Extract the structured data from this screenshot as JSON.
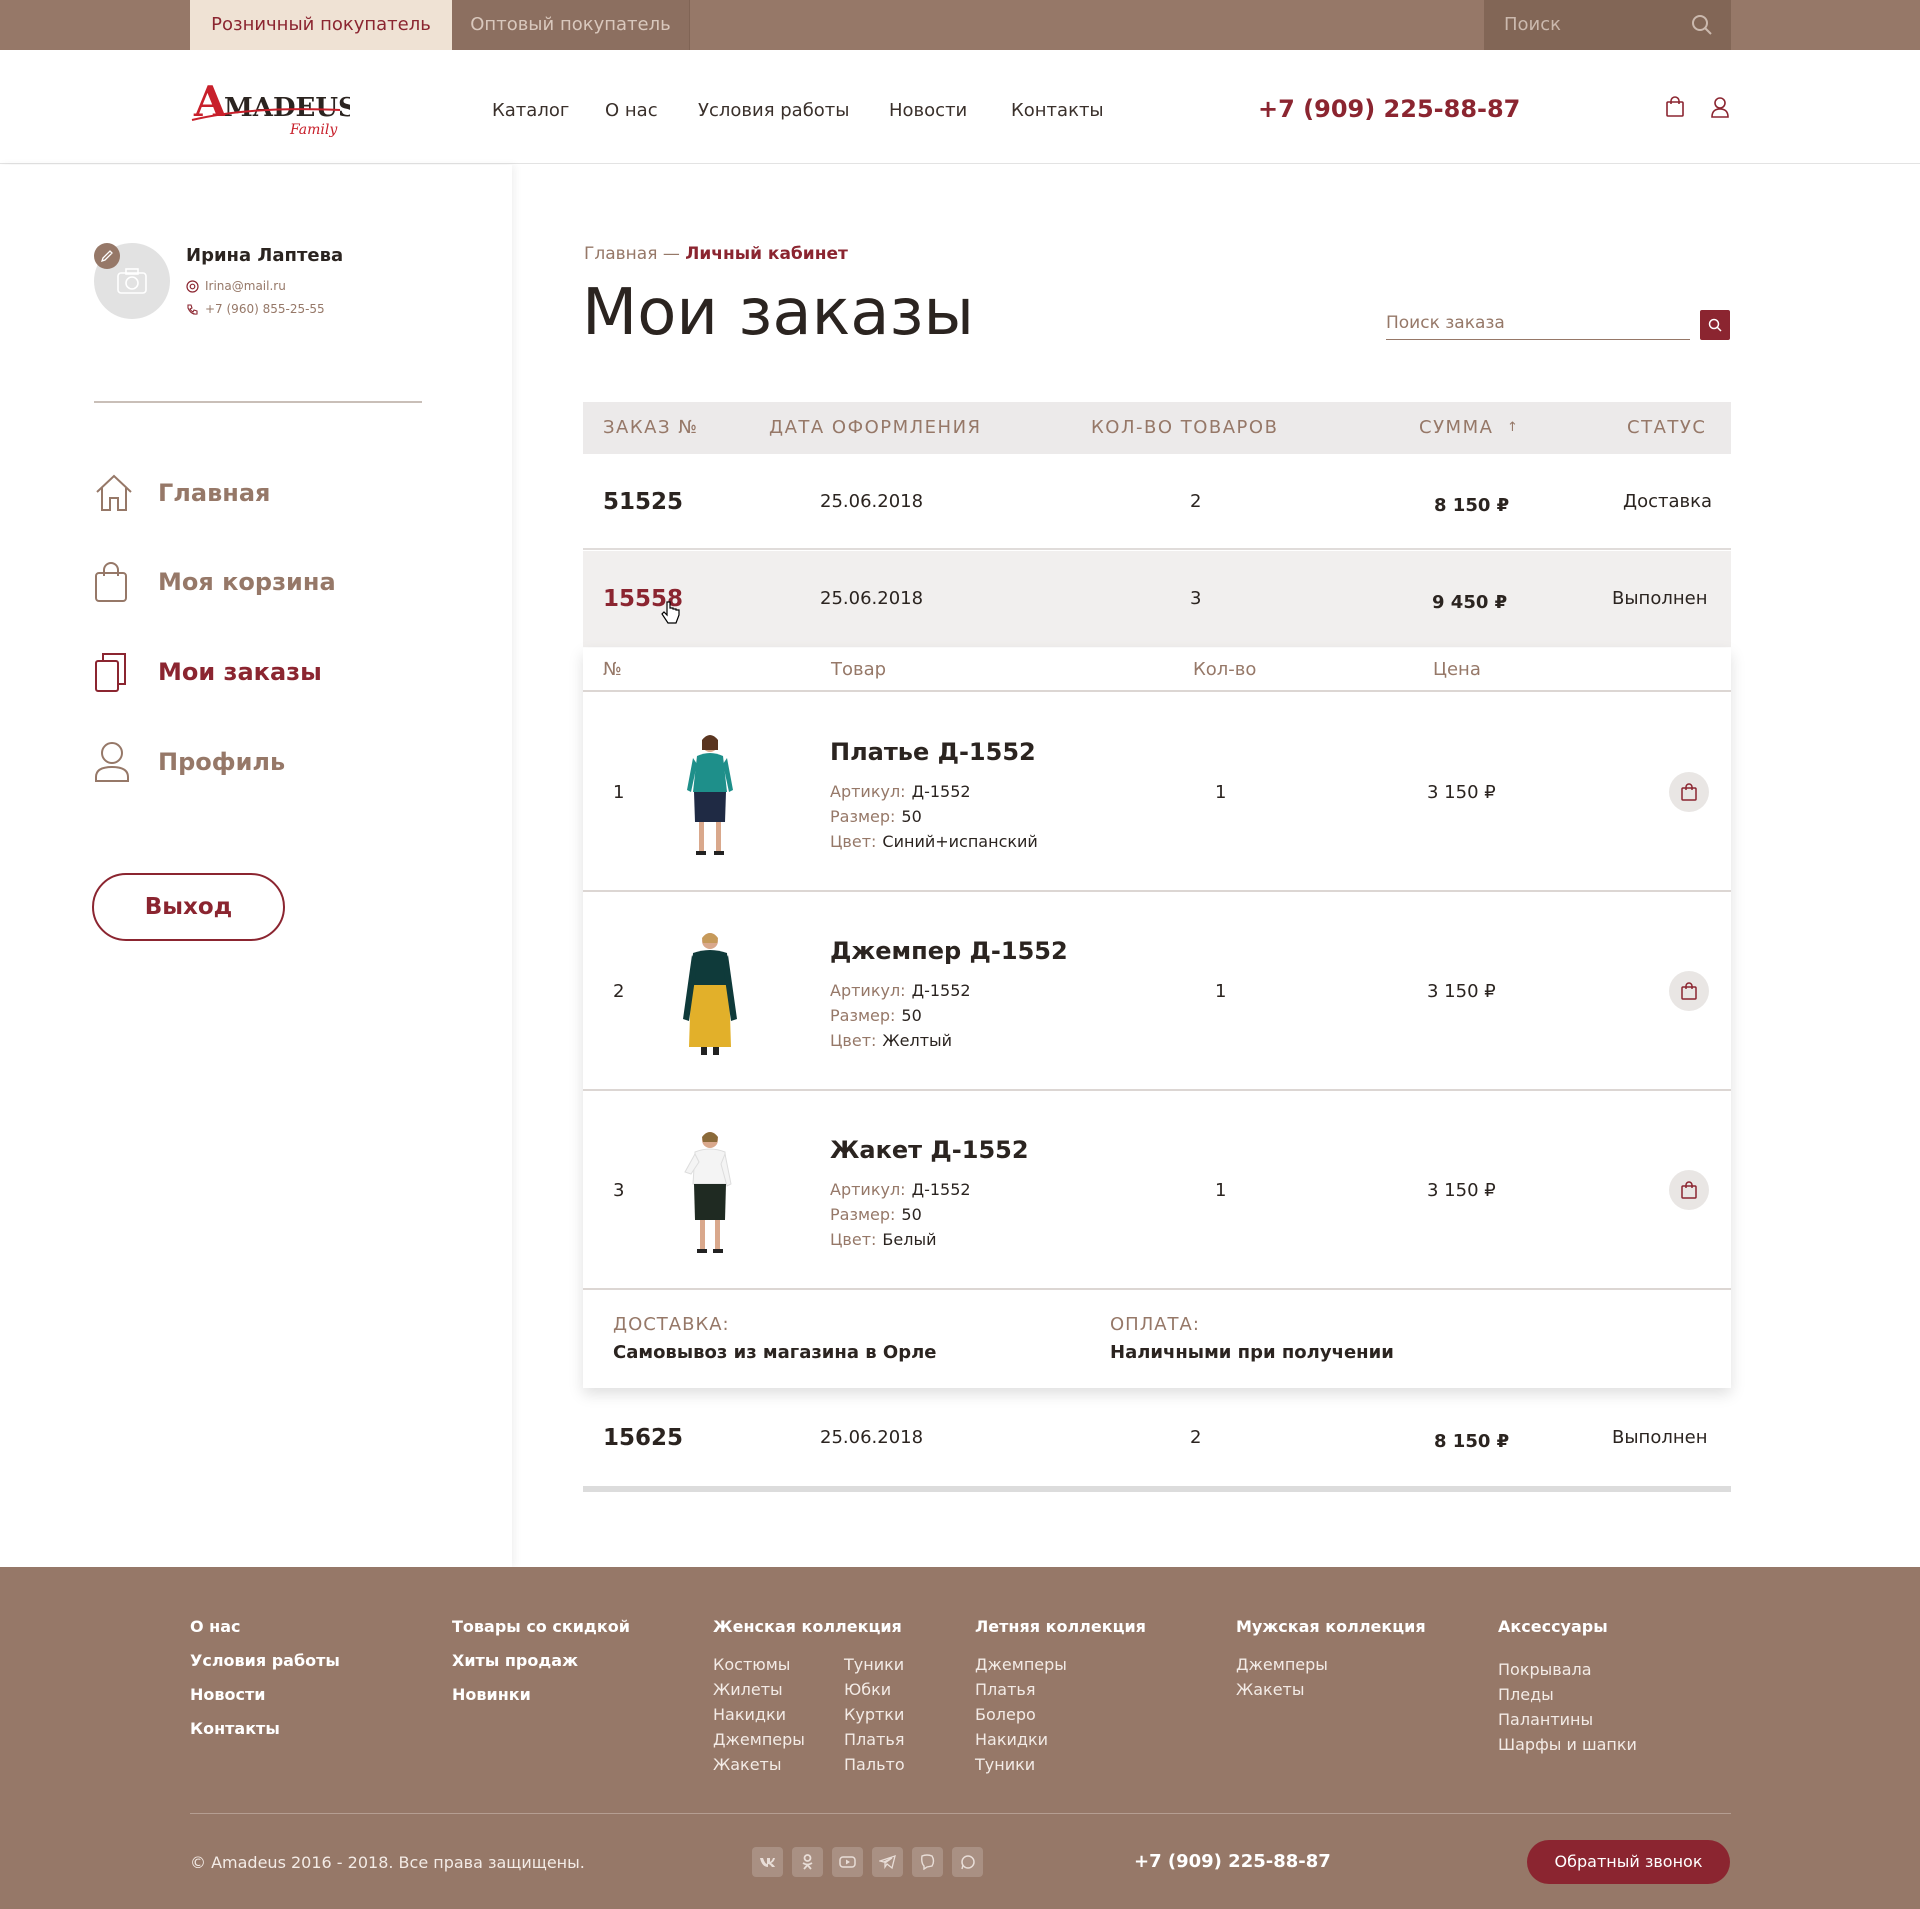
{
  "topbar": {
    "tab_retail": "Розничный покупатель",
    "tab_wholesale": "Оптовый покупатель",
    "search_placeholder": "Поиск"
  },
  "header": {
    "logo_text": "AMADEUS",
    "logo_sub": "Family",
    "nav": [
      "Каталог",
      "О нас",
      "Условия работы",
      "Новости",
      "Контакты"
    ],
    "phone": "+7 (909) 225-88-87"
  },
  "user": {
    "name": "Ирина Лаптева",
    "email": "Irina@mail.ru",
    "phone": "+7 (960) 855-25-55"
  },
  "sidebar": {
    "items": [
      {
        "label": "Главная",
        "icon": "home-icon"
      },
      {
        "label": "Моя корзина",
        "icon": "shopping-bag-icon"
      },
      {
        "label": "Мои заказы",
        "icon": "orders-icon",
        "active": true
      },
      {
        "label": "Профиль",
        "icon": "user-icon"
      }
    ],
    "logout": "Выход"
  },
  "breadcrumb": {
    "home": "Главная",
    "sep": "—",
    "current": "Личный кабинет"
  },
  "page_title": "Мои заказы",
  "order_search_placeholder": "Поиск заказа",
  "orders_table": {
    "headers": [
      "ЗАКАЗ №",
      "ДАТА ОФОРМЛЕНИЯ",
      "КОЛ-ВО ТОВАРОВ",
      "СУММА",
      "СТАТУС"
    ],
    "sort_indicator": "↑",
    "rows": [
      {
        "no": "51525",
        "date": "25.06.2018",
        "qty": "2",
        "sum": "8 150",
        "currency": "₽",
        "status": "Доставка"
      },
      {
        "no": "15558",
        "date": "25.06.2018",
        "qty": "3",
        "sum": "9 450",
        "currency": "₽",
        "status": "Выполнен"
      },
      {
        "no": "15625",
        "date": "25.06.2018",
        "qty": "2",
        "sum": "8 150",
        "currency": "₽",
        "status": "Выполнен"
      }
    ]
  },
  "order_detail": {
    "headers": [
      "№",
      "Товар",
      "Кол-во",
      "Цена"
    ],
    "labels": {
      "article": "Артикул:",
      "size": "Размер:",
      "color": "Цвет:"
    },
    "items": [
      {
        "num": "1",
        "name": "Платье Д-1552",
        "article": "Д-1552",
        "size": "50",
        "color": "Синий+испанский",
        "qty": "1",
        "price": "3 150 ₽"
      },
      {
        "num": "2",
        "name": "Джемпер Д-1552",
        "article": "Д-1552",
        "size": "50",
        "color": "Желтый",
        "qty": "1",
        "price": "3 150 ₽"
      },
      {
        "num": "3",
        "name": "Жакет Д-1552",
        "article": "Д-1552",
        "size": "50",
        "color": "Белый",
        "qty": "1",
        "price": "3 150 ₽"
      }
    ],
    "delivery_label": "ДОСТАВКА:",
    "delivery_value": "Самовывоз из магазина в Орле",
    "payment_label": "ОПЛАТА:",
    "payment_value": "Наличными при получении"
  },
  "footer": {
    "col1": [
      "О нас",
      "Условия работы",
      "Новости",
      "Контакты"
    ],
    "col2": [
      "Товары со скидкой",
      "Хиты продаж",
      "Новинки"
    ],
    "women": {
      "title": "Женская коллекция",
      "a": [
        "Костюмы",
        "Жилеты",
        "Накидки",
        "Джемперы",
        "Жакеты"
      ],
      "b": [
        "Туники",
        "Юбки",
        "Куртки",
        "Платья",
        "Пальто"
      ]
    },
    "summer": {
      "title": "Летняя коллекция",
      "items": [
        "Джемперы",
        "Платья",
        "Болеро",
        "Накидки",
        "Туники"
      ]
    },
    "men": {
      "title": "Мужская коллекция",
      "items": [
        "Джемперы",
        "Жакеты"
      ]
    },
    "acc": {
      "title": "Аксессуары",
      "items": [
        "Покрывала",
        "Пледы",
        "Палантины",
        "Шарфы и шапки"
      ]
    },
    "copyright": "© Amadeus 2016 - 2018. Все права защищены.",
    "socials": [
      "vk-icon",
      "odnoklassniki-icon",
      "youtube-icon",
      "telegram-icon",
      "viber-icon",
      "whatsapp-icon"
    ],
    "phone": "+7 (909) 225-88-87",
    "callback": "Обратный звонок"
  },
  "colors": {
    "brand": "#8b2530",
    "brown": "#967868",
    "beige": "#efe2d4"
  }
}
